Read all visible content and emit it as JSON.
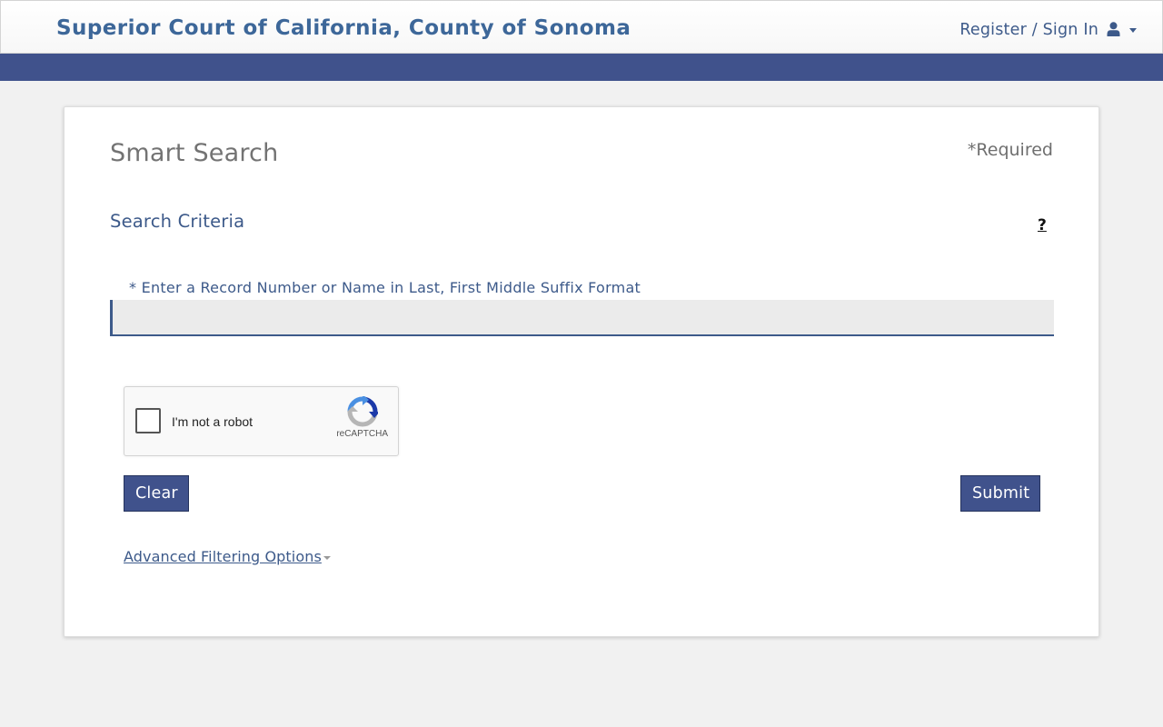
{
  "header": {
    "title": "Superior Court of California, County of Sonoma",
    "signin_label": "Register / Sign In",
    "user_icon": "user-icon",
    "dropdown_icon": "caret-down-icon"
  },
  "colors": {
    "brand_blue": "#40528c",
    "title_blue": "#3d6799",
    "text_blue": "#3d5a8a"
  },
  "search": {
    "page_title": "Smart Search",
    "required_note": "*Required",
    "section_title": "Search Criteria",
    "help_icon": "?",
    "field_label": "* Enter a Record Number or Name in Last, First Middle Suffix Format",
    "input_value": "",
    "input_placeholder": ""
  },
  "recaptcha": {
    "label": "I'm not a robot",
    "brand": "reCAPTCHA",
    "checked": false
  },
  "actions": {
    "clear_label": "Clear",
    "submit_label": "Submit",
    "advanced_label": "Advanced Filtering Options"
  }
}
